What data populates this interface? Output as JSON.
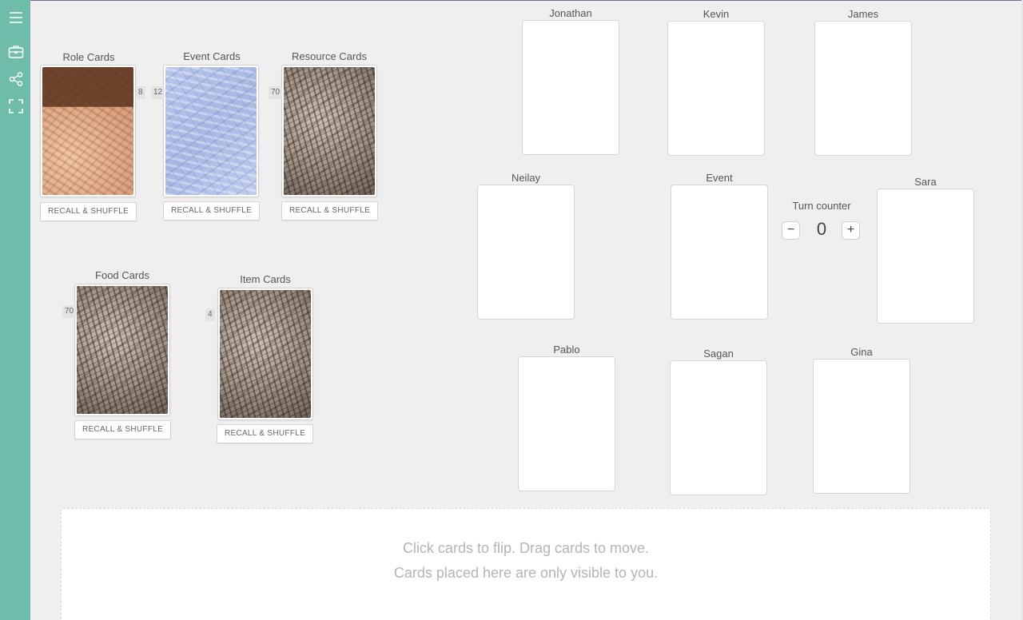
{
  "sidebar": {
    "icons": [
      "menu-icon",
      "briefcase-icon",
      "share-icon",
      "fullscreen-icon"
    ]
  },
  "decks": {
    "role": {
      "title": "Role Cards",
      "count": "8",
      "button": "RECALL & SHUFFLE"
    },
    "event": {
      "title": "Event Cards",
      "count": "12",
      "button": "RECALL & SHUFFLE"
    },
    "resource": {
      "title": "Resource Cards",
      "count": "70",
      "button": "RECALL & SHUFFLE"
    },
    "food": {
      "title": "Food Cards",
      "count": "70",
      "button": "RECALL & SHUFFLE"
    },
    "item": {
      "title": "Item Cards",
      "count": "4",
      "button": "RECALL & SHUFFLE"
    }
  },
  "slots": {
    "jonathan": "Jonathan",
    "kevin": "Kevin",
    "james": "James",
    "neilay": "Neilay",
    "event": "Event",
    "sara": "Sara",
    "pablo": "Pablo",
    "sagan": "Sagan",
    "gina": "Gina"
  },
  "turn_counter": {
    "label": "Turn counter",
    "minus": "−",
    "plus": "+",
    "value": "0"
  },
  "hand": {
    "line1": "Click cards to flip.   Drag cards to move.",
    "line2": "Cards placed here are only visible to you."
  },
  "colors": {
    "sidebar": "#6fbcab",
    "background": "#efefef"
  }
}
